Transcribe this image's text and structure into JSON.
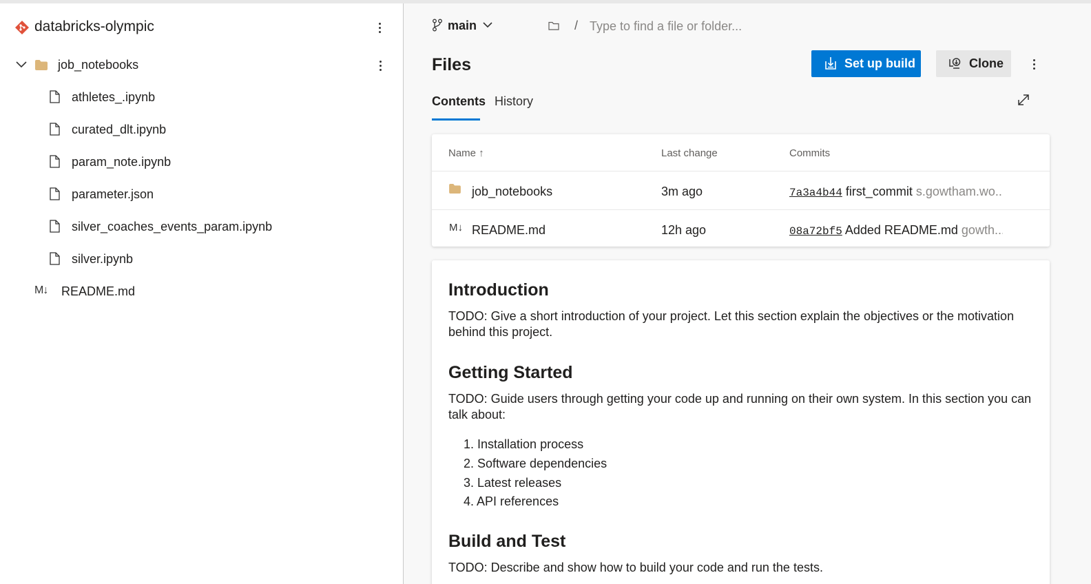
{
  "sidebar": {
    "repo_name": "databricks-olympic",
    "folder": {
      "label": "job_notebooks"
    },
    "files": [
      {
        "label": "athletes_.ipynb"
      },
      {
        "label": "curated_dlt.ipynb"
      },
      {
        "label": "param_note.ipynb"
      },
      {
        "label": "parameter.json"
      },
      {
        "label": "silver_coaches_events_param.ipynb"
      },
      {
        "label": "silver.ipynb"
      }
    ],
    "readme": {
      "icon_text": "M↓",
      "label": "README.md"
    }
  },
  "toolbar": {
    "branch": "main",
    "path_separator": "/",
    "search_placeholder": "Type to find a file or folder..."
  },
  "header": {
    "title": "Files",
    "setup_build_label": "Set up build",
    "clone_label": "Clone"
  },
  "tabs": [
    {
      "label": "Contents",
      "selected": true
    },
    {
      "label": "History",
      "selected": false
    }
  ],
  "table": {
    "columns": {
      "name": "Name ↑",
      "last_change": "Last change",
      "commits": "Commits"
    },
    "rows": [
      {
        "name": "job_notebooks",
        "type": "folder",
        "last_change": "3m ago",
        "hash": "7a3a4b44",
        "message": "first_commit",
        "author": "s.gowtham.wo..."
      },
      {
        "name": "README.md",
        "type": "markdown",
        "icon_text": "M↓",
        "last_change": "12h ago",
        "hash": "08a72bf5",
        "message": "Added README.md",
        "author": "gowth..."
      }
    ]
  },
  "readme": {
    "intro_heading": "Introduction",
    "intro_text": "TODO: Give a short introduction of your project. Let this section explain the objectives or the motivation behind this project.",
    "start_heading": "Getting Started",
    "start_text": "TODO: Guide users through getting your code up and running on their own system. In this section you can talk about:",
    "steps": [
      "1. Installation process",
      "2. Software dependencies",
      "3. Latest releases",
      "4. API references"
    ],
    "build_heading": "Build and Test",
    "build_text": "TODO: Describe and show how to build your code and run the tests."
  },
  "colors": {
    "accent": "#0078d4",
    "repo_icon": "#e0513a",
    "folder": "#dcb67a"
  },
  "icons": {
    "repo": "git-repo-icon",
    "folder": "folder-icon",
    "file": "file-icon",
    "branch": "branch-icon",
    "build": "build-icon",
    "clone": "clone-icon",
    "expand": "expand-icon"
  }
}
